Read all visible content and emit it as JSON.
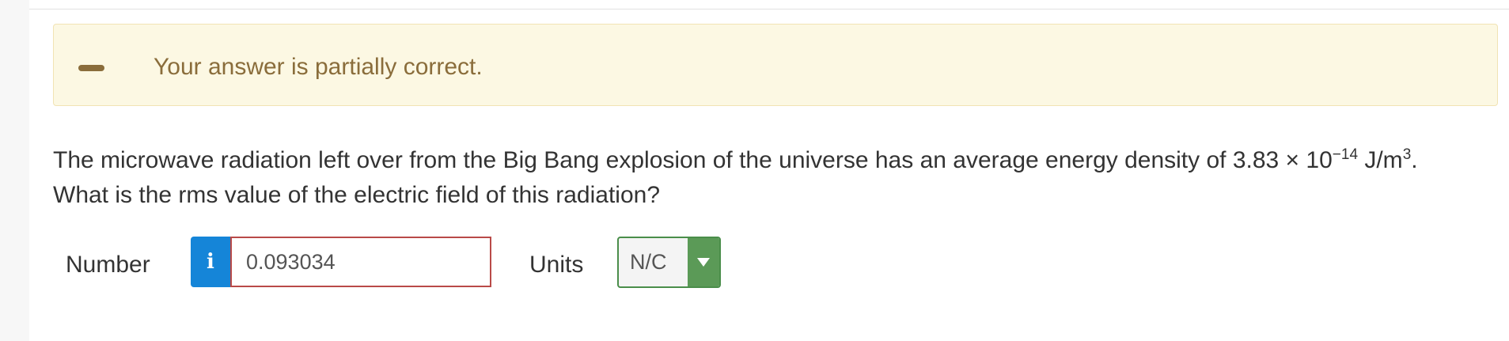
{
  "feedback": {
    "icon": "minus-icon",
    "message": "Your answer is partially correct."
  },
  "question": {
    "line1_prefix": "The microwave radiation left over from the Big Bang explosion of the universe has an average energy density of 3.83 × 10",
    "exponent": "−14",
    "unit_base": " J/m",
    "unit_exponent": "3",
    "line1_suffix": ".",
    "line2": "What is the rms value of the electric field of this radiation?"
  },
  "answer": {
    "number_label": "Number",
    "info_icon": "info-icon",
    "info_glyph": "i",
    "value": "0.093034",
    "units_label": "Units",
    "units_value": "N/C",
    "units_caret_icon": "caret-down-icon"
  },
  "colors": {
    "feedback_background": "#fcf8e3",
    "feedback_text": "#8a6d3b",
    "info_button": "#1585d8",
    "input_error_border": "#b94a48",
    "units_border": "#4a8e4a",
    "units_caret": "#5b9a57"
  }
}
